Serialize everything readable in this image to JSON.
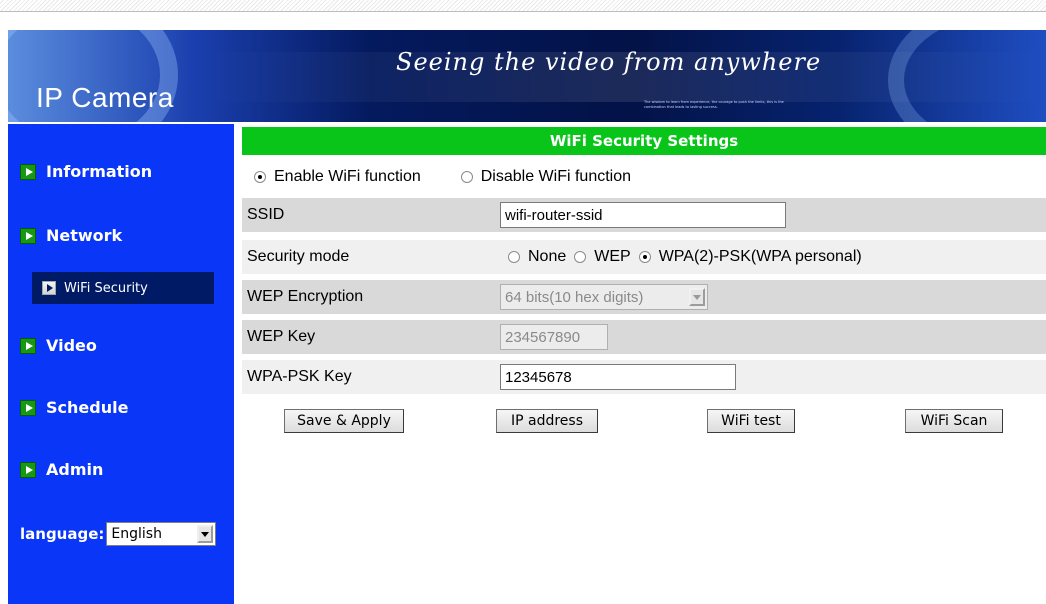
{
  "header": {
    "logo": "IP Camera",
    "slogan": "Seeing the video from anywhere",
    "fine_print": "The wisdom to learn from experience, the courage to push the limits, this is the combination that leads to lasting success."
  },
  "sidebar": {
    "items": [
      {
        "label": "Information",
        "icon": "arrow-right-icon"
      },
      {
        "label": "Network",
        "icon": "arrow-right-icon"
      },
      {
        "label": "Video",
        "icon": "arrow-right-icon"
      },
      {
        "label": "Schedule",
        "icon": "arrow-right-icon"
      },
      {
        "label": "Admin",
        "icon": "arrow-right-icon"
      }
    ],
    "sub_item": {
      "label": "WiFi Security",
      "active": true
    },
    "language_label": "language:",
    "language_value": "English"
  },
  "main": {
    "title": "WiFi Security Settings",
    "wifi_toggle": {
      "enable_label": "Enable WiFi function",
      "disable_label": "Disable WiFi function",
      "selected": "enable"
    },
    "ssid": {
      "label": "SSID",
      "value": "wifi-router-ssid"
    },
    "security_mode": {
      "label": "Security mode",
      "options": [
        "None",
        "WEP",
        "WPA(2)-PSK(WPA personal)"
      ],
      "selected": "WPA(2)-PSK(WPA personal)"
    },
    "wep_encryption": {
      "label": "WEP Encryption",
      "value": "64 bits(10 hex digits)"
    },
    "wep_key": {
      "label": "WEP Key",
      "value": "234567890"
    },
    "wpa_psk_key": {
      "label": "WPA-PSK Key",
      "value": "12345678"
    },
    "buttons": {
      "save_apply": "Save & Apply",
      "ip_address": "IP address",
      "wifi_test": "WiFi test",
      "wifi_scan": "WiFi Scan"
    }
  },
  "colors": {
    "sidebar": "#0a36f7",
    "title_bar": "#09c51a",
    "active_sub_item": "#001a66"
  }
}
